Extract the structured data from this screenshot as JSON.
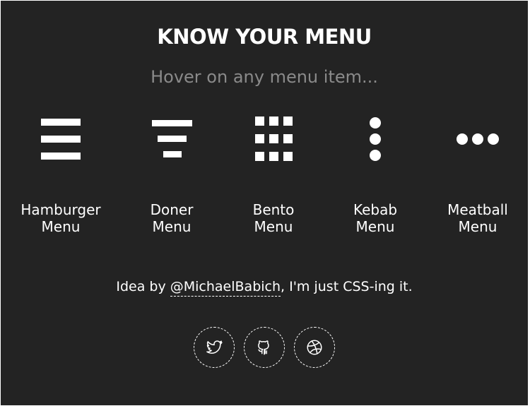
{
  "header": {
    "title": "KNOW YOUR MENU",
    "subtitle": "Hover on any menu item..."
  },
  "menu_items": [
    {
      "line1": "Hamburger",
      "line2": "Menu",
      "icon": "hamburger-icon"
    },
    {
      "line1": "Doner",
      "line2": "Menu",
      "icon": "doner-icon"
    },
    {
      "line1": "Bento",
      "line2": "Menu",
      "icon": "bento-icon"
    },
    {
      "line1": "Kebab",
      "line2": "Menu",
      "icon": "kebab-icon"
    },
    {
      "line1": "Meatball",
      "line2": "Menu",
      "icon": "meatball-icon"
    }
  ],
  "footer": {
    "credit_prefix": "Idea by ",
    "credit_link": "@MichaelBabich",
    "credit_suffix": ", I'm just CSS-ing it.",
    "social": [
      {
        "icon": "twitter-icon"
      },
      {
        "icon": "github-icon"
      },
      {
        "icon": "dribbble-icon"
      }
    ]
  },
  "colors": {
    "background": "#232323",
    "text": "#ffffff",
    "subtitle": "#8a8a8a"
  }
}
